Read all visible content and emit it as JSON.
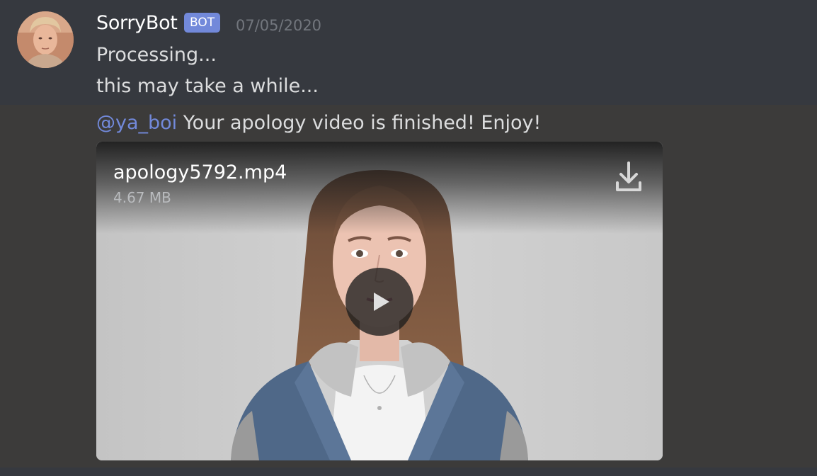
{
  "message": {
    "author": "SorryBot",
    "bot_tag": "BOT",
    "timestamp": "07/05/2020",
    "lines": [
      "Processing...",
      "this may take a while..."
    ],
    "mention": "@ya_boi",
    "followup_text": " Your apology video is finished! Enjoy!"
  },
  "attachment": {
    "file_name": "apology5792.mp4",
    "file_size": "4.67 MB",
    "download_icon": "download-icon",
    "play_icon": "play-icon"
  },
  "colors": {
    "background": "#36393f",
    "mention": "#7289da",
    "bot_tag": "#7289da",
    "text": "#dcddde",
    "timestamp": "#72767d"
  }
}
